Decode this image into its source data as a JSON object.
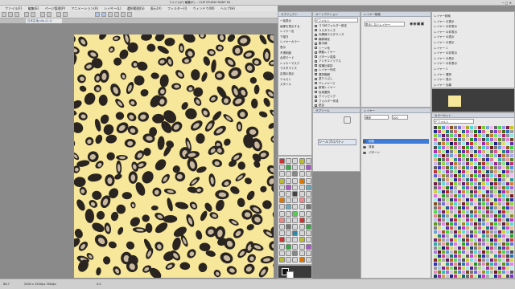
{
  "window": {
    "title": "ファイル(F) 編集(E) ... CLIP STUDIO PAINT EX"
  },
  "menu": [
    "ファイル(F)",
    "編集(E)",
    "ページ管理(P)",
    "アニメーション(A)",
    "レイヤー(L)",
    "選択範囲(S)",
    "表示(V)",
    "フィルター(I)",
    "ウィンドウ(W)",
    "ヘルプ(H)"
  ],
  "doc_tab": {
    "label": "日本生地.clip (1:1)"
  },
  "colors": {
    "paper": "#f7e79a",
    "spot_outer": "#2a2420",
    "spot_inner": "#c8b9a0",
    "panel_head": "#cfd6df",
    "highlight": "#3d7bd6"
  },
  "tool_property": {
    "title": "オブジェクト",
    "items": [
      "一括表示",
      "画像を表示する",
      "レイヤー名",
      "下描き",
      "レイヤーカラー",
      "表示",
      "不透明度",
      "合成モード",
      "レイヤーマスク",
      "ラスタライズ",
      "定規の表示",
      "テキスト",
      "スタイル"
    ]
  },
  "auto_actions": {
    "title": "オートアクション",
    "set_name": "デフォルト",
    "items": [
      "コマ枠フォルダー設定",
      "ラスタライズ",
      "効果線ラスタライズ",
      "輪郭線化",
      "集中線",
      "トーン化",
      "移動レイヤー",
      "パターン変換",
      "アンチエイリアス",
      "縦横比保持",
      "レイヤー作成",
      "選択範囲",
      "塗りつぶし",
      "下レイヤーで",
      "新規レイヤー",
      "色域選択",
      "クリッピング",
      "フォルダー作成",
      "統合"
    ]
  },
  "layer_search": {
    "title": "レイヤー検索",
    "query": "表示しないレイヤー",
    "results": [
      "レイヤー検索",
      "レイヤー の表示",
      "レイヤー の非表示",
      "レイヤー の非表示",
      "レイヤー の表示",
      "レイヤー の表示",
      "レイヤー 1",
      "レイヤー の非表示",
      "レイヤー の表示",
      "レイヤー の非表示",
      "レイヤー 2",
      "レイヤー 選択",
      "レイヤー 表示",
      "レイヤー 効果"
    ]
  },
  "layer_panel": {
    "title": "レイヤー",
    "blend_mode": "通常",
    "opacity": "100",
    "layers": [
      "用紙",
      "背景",
      "パターン"
    ]
  },
  "color_set": {
    "title": "カラーセット",
    "set_name": "デフォルト"
  },
  "sub_tool": {
    "title": "サブツール",
    "label": "ツールプロパティ"
  },
  "status": {
    "zoom": "66.7",
    "info": "2400 x 3200px 350dpi",
    "coords": "0.0"
  }
}
